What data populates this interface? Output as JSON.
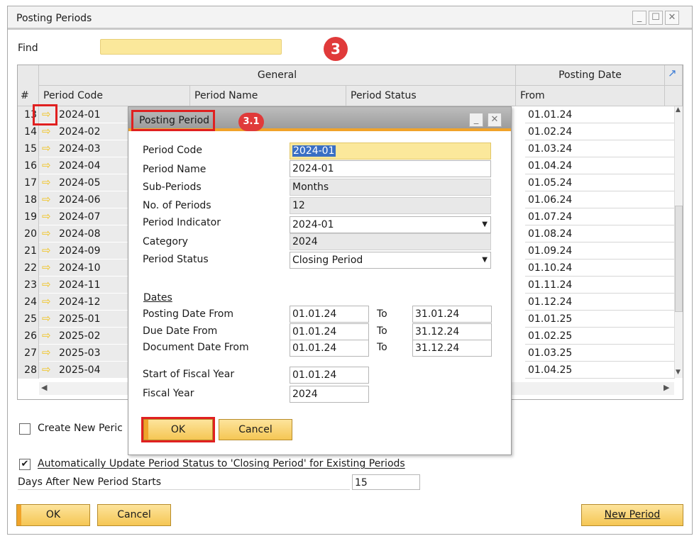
{
  "window": {
    "title": "Posting Periods"
  },
  "find": {
    "label": "Find",
    "value": ""
  },
  "badges": {
    "main": "3",
    "dialog": "3.1"
  },
  "grid": {
    "group_general": "General",
    "group_posting": "Posting Date",
    "col_num": "#",
    "col_period_code": "Period Code",
    "col_period_name": "Period Name",
    "col_period_status": "Period Status",
    "col_from": "From",
    "rows": [
      {
        "num": "13",
        "code": "2024-01",
        "from": "01.01.24"
      },
      {
        "num": "14",
        "code": "2024-02",
        "from": "01.02.24"
      },
      {
        "num": "15",
        "code": "2024-03",
        "from": "01.03.24"
      },
      {
        "num": "16",
        "code": "2024-04",
        "from": "01.04.24"
      },
      {
        "num": "17",
        "code": "2024-05",
        "from": "01.05.24"
      },
      {
        "num": "18",
        "code": "2024-06",
        "from": "01.06.24"
      },
      {
        "num": "19",
        "code": "2024-07",
        "from": "01.07.24"
      },
      {
        "num": "20",
        "code": "2024-08",
        "from": "01.08.24"
      },
      {
        "num": "21",
        "code": "2024-09",
        "from": "01.09.24"
      },
      {
        "num": "22",
        "code": "2024-10",
        "from": "01.10.24"
      },
      {
        "num": "23",
        "code": "2024-11",
        "from": "01.11.24"
      },
      {
        "num": "24",
        "code": "2024-12",
        "from": "01.12.24"
      },
      {
        "num": "25",
        "code": "2025-01",
        "from": "01.01.25"
      },
      {
        "num": "26",
        "code": "2025-02",
        "from": "01.02.25"
      },
      {
        "num": "27",
        "code": "2025-03",
        "from": "01.03.25"
      },
      {
        "num": "28",
        "code": "2025-04",
        "from": "01.04.25"
      }
    ]
  },
  "dialog": {
    "title": "Posting Period",
    "period_code_label": "Period Code",
    "period_code": "2024-01",
    "period_name_label": "Period Name",
    "period_name": "2024-01",
    "sub_periods_label": "Sub-Periods",
    "sub_periods": "Months",
    "num_periods_label": "No. of Periods",
    "num_periods": "12",
    "period_indicator_label": "Period Indicator",
    "period_indicator": "2024-01",
    "category_label": "Category",
    "category": "2024",
    "period_status_label": "Period Status",
    "period_status": "Closing Period",
    "dates_heading": "Dates",
    "to_label": "To",
    "posting_from_label": "Posting Date From",
    "posting_from": "01.01.24",
    "posting_to": "31.01.24",
    "due_from_label": "Due Date From",
    "due_from": "01.01.24",
    "due_to": "31.12.24",
    "doc_from_label": "Document Date From",
    "doc_from": "01.01.24",
    "doc_to": "31.12.24",
    "fiscal_start_label": "Start of Fiscal Year",
    "fiscal_start": "01.01.24",
    "fiscal_year_label": "Fiscal Year",
    "fiscal_year": "2024",
    "ok_label": "OK",
    "cancel_label": "Cancel"
  },
  "bottom": {
    "create_new_label": "Create New Peric",
    "auto_update_label": "Automatically Update Period Status to 'Closing Period' for Existing Periods",
    "auto_update_checked": true,
    "days_after_label": "Days After New Period Starts",
    "days_after_value": "15",
    "ok_label": "OK",
    "cancel_label": "Cancel",
    "new_period_label": "New Period"
  },
  "colors": {
    "accent": "#f0a32a",
    "highlight_field": "#fbe89b",
    "badge": "#e03a3a"
  }
}
